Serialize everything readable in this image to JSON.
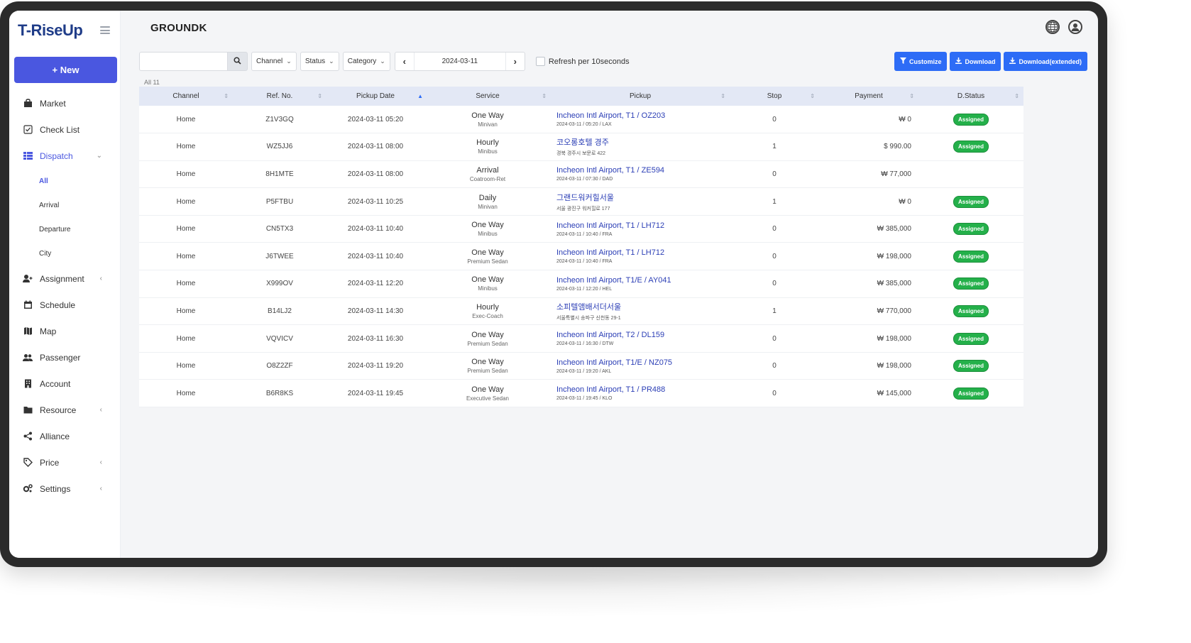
{
  "app": {
    "logo": "T-RiseUp",
    "page_title": "GROUNDK"
  },
  "sidebar": {
    "new_button": "+ New",
    "items": [
      {
        "label": "Market",
        "icon": "bag-icon",
        "chevron": ""
      },
      {
        "label": "Check List",
        "icon": "checklist-icon",
        "chevron": ""
      },
      {
        "label": "Dispatch",
        "icon": "dispatch-list-icon",
        "chevron": "⌄"
      },
      {
        "label": "Assignment",
        "icon": "user-add-icon",
        "chevron": "‹"
      },
      {
        "label": "Schedule",
        "icon": "calendar-icon",
        "chevron": ""
      },
      {
        "label": "Map",
        "icon": "map-icon",
        "chevron": ""
      },
      {
        "label": "Passenger",
        "icon": "users-icon",
        "chevron": ""
      },
      {
        "label": "Account",
        "icon": "building-icon",
        "chevron": ""
      },
      {
        "label": "Resource",
        "icon": "folder-icon",
        "chevron": "‹"
      },
      {
        "label": "Alliance",
        "icon": "share-icon",
        "chevron": ""
      },
      {
        "label": "Price",
        "icon": "tag-icon",
        "chevron": "‹"
      },
      {
        "label": "Settings",
        "icon": "gears-icon",
        "chevron": "‹"
      }
    ],
    "dispatch_sub": [
      "All",
      "Arrival",
      "Departure",
      "City"
    ]
  },
  "toolbar": {
    "search_value": "",
    "search_placeholder": "",
    "filters": [
      "Channel",
      "Status",
      "Category"
    ],
    "date": "2024-03-11",
    "refresh_label": "Refresh per 10seconds",
    "buttons": [
      "Customize",
      "Download",
      "Download(extended)"
    ]
  },
  "table": {
    "count_label": "All 11",
    "columns": [
      "Channel",
      "Ref. No.",
      "Pickup Date",
      "Service",
      "Pickup",
      "Stop",
      "Payment",
      "D.Status"
    ],
    "rows": [
      {
        "channel": "Home",
        "ref": "Z1V3GQ",
        "date": "2024-03-11 05:20",
        "svc1": "One Way",
        "svc2": "Minivan",
        "pick1": "Incheon Intl Airport, T1 / OZ203",
        "pick2": "2024-03-11 / 05:20 / LAX",
        "stop": "0",
        "pay": "₩ 0",
        "status": "Assigned"
      },
      {
        "channel": "Home",
        "ref": "WZ5JJ6",
        "date": "2024-03-11 08:00",
        "svc1": "Hourly",
        "svc2": "Minibus",
        "pick1": "코오롱호텔 경주",
        "pick2": "경북 경주시 보문로 422",
        "stop": "1",
        "pay": "$ 990.00",
        "status": "Assigned"
      },
      {
        "channel": "Home",
        "ref": "8H1MTE",
        "date": "2024-03-11 08:00",
        "svc1": "Arrival",
        "svc2": "Coatroom-Ret",
        "pick1": "Incheon Intl Airport, T1 / ZE594",
        "pick2": "2024-03-11 / 07:30 / DAD",
        "stop": "0",
        "pay": "₩ 77,000",
        "status": ""
      },
      {
        "channel": "Home",
        "ref": "P5FTBU",
        "date": "2024-03-11 10:25",
        "svc1": "Daily",
        "svc2": "Minivan",
        "pick1": "그랜드워커힐서울",
        "pick2": "서울 광진구 워커힐로 177",
        "stop": "1",
        "pay": "₩ 0",
        "status": "Assigned"
      },
      {
        "channel": "Home",
        "ref": "CN5TX3",
        "date": "2024-03-11 10:40",
        "svc1": "One Way",
        "svc2": "Minibus",
        "pick1": "Incheon Intl Airport, T1 / LH712",
        "pick2": "2024-03-11 / 10:40 / FRA",
        "stop": "0",
        "pay": "₩ 385,000",
        "status": "Assigned"
      },
      {
        "channel": "Home",
        "ref": "J6TWEE",
        "date": "2024-03-11 10:40",
        "svc1": "One Way",
        "svc2": "Premium Sedan",
        "pick1": "Incheon Intl Airport, T1 / LH712",
        "pick2": "2024-03-11 / 10:40 / FRA",
        "stop": "0",
        "pay": "₩ 198,000",
        "status": "Assigned"
      },
      {
        "channel": "Home",
        "ref": "X999OV",
        "date": "2024-03-11 12:20",
        "svc1": "One Way",
        "svc2": "Minibus",
        "pick1": "Incheon Intl Airport, T1/E / AY041",
        "pick2": "2024-03-11 / 12:20 / HEL",
        "stop": "0",
        "pay": "₩ 385,000",
        "status": "Assigned"
      },
      {
        "channel": "Home",
        "ref": "B14LJ2",
        "date": "2024-03-11 14:30",
        "svc1": "Hourly",
        "svc2": "Exec-Coach",
        "pick1": "소피텔앰배서더서울",
        "pick2": "서울특별시 송파구 신천동 29-1",
        "stop": "1",
        "pay": "₩ 770,000",
        "status": "Assigned"
      },
      {
        "channel": "Home",
        "ref": "VQVICV",
        "date": "2024-03-11 16:30",
        "svc1": "One Way",
        "svc2": "Premium Sedan",
        "pick1": "Incheon Intl Airport, T2 / DL159",
        "pick2": "2024-03-11 / 16:30 / DTW",
        "stop": "0",
        "pay": "₩ 198,000",
        "status": "Assigned"
      },
      {
        "channel": "Home",
        "ref": "O8Z2ZF",
        "date": "2024-03-11 19:20",
        "svc1": "One Way",
        "svc2": "Premium Sedan",
        "pick1": "Incheon Intl Airport, T1/E / NZ075",
        "pick2": "2024-03-11 / 19:20 / AKL",
        "stop": "0",
        "pay": "₩ 198,000",
        "status": "Assigned"
      },
      {
        "channel": "Home",
        "ref": "B6R8KS",
        "date": "2024-03-11 19:45",
        "svc1": "One Way",
        "svc2": "Executive Sedan",
        "pick1": "Incheon Intl Airport, T1 / PR488",
        "pick2": "2024-03-11 / 19:45 / KLO",
        "stop": "0",
        "pay": "₩ 145,000",
        "status": "Assigned"
      }
    ]
  },
  "colors": {
    "primary": "#4a57e0",
    "button_blue": "#2d6cf6",
    "assigned_green": "#24b04a",
    "link_blue": "#2a3db5",
    "header_bg": "#e3e8f5"
  }
}
